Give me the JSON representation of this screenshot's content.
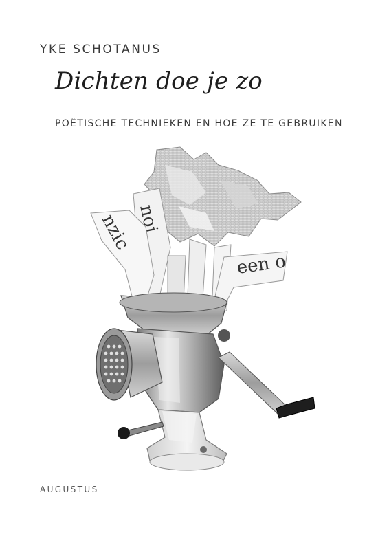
{
  "cover": {
    "author": "YKE SCHOTANUS",
    "title": "Dichten doe je zo",
    "subtitle": "POËTISCHE TECHNIEKEN EN HOE ZE TE GEBRUIKEN",
    "publisher": "AUGUSTUS"
  },
  "illustration": {
    "paper_strips": [
      "noi",
      "nzic",
      "een o"
    ]
  },
  "colors": {
    "background": "#ffffff",
    "text": "#3a3a3a",
    "metal_light": "#e8e8e8",
    "metal_dark": "#6d6d6d"
  }
}
